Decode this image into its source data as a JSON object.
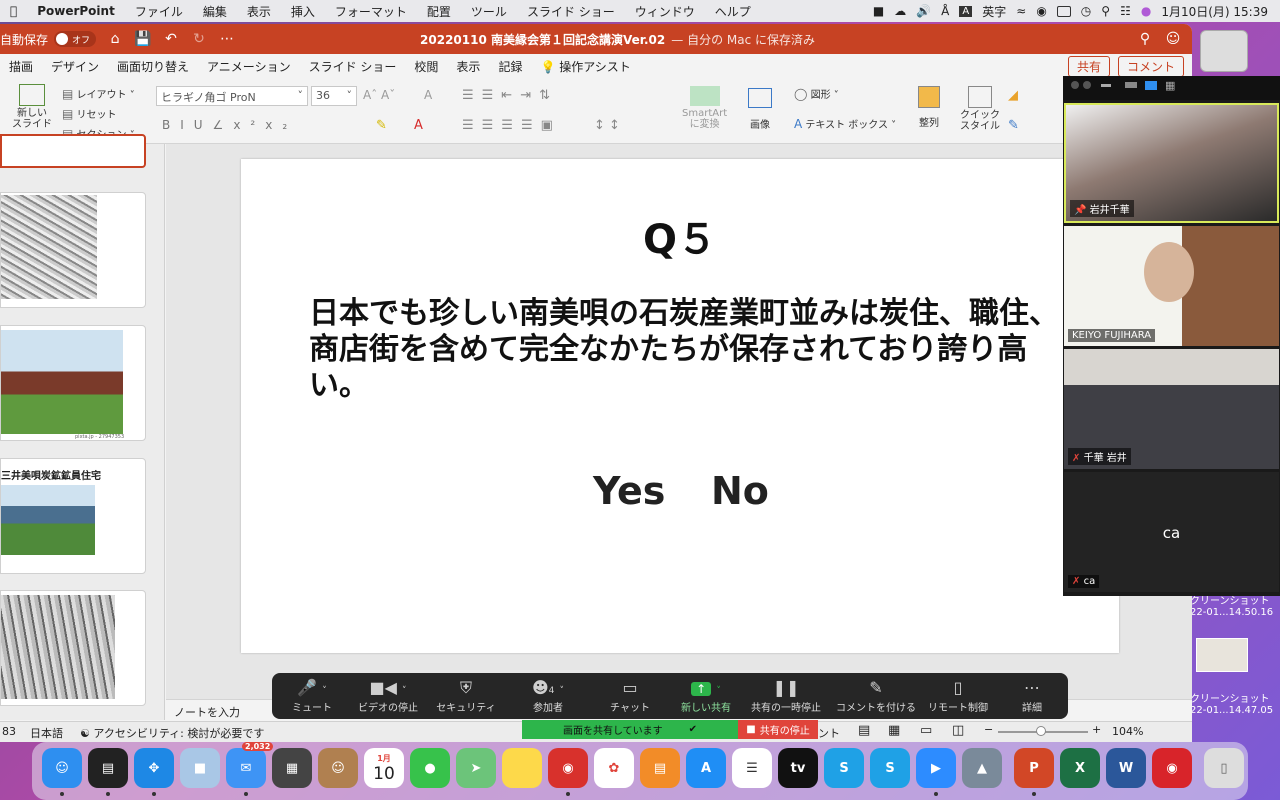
{
  "menubar": {
    "app": "PowerPoint",
    "items": [
      "ファイル",
      "編集",
      "表示",
      "挿入",
      "フォーマット",
      "配置",
      "ツール",
      "スライド ショー",
      "ウィンドウ",
      "ヘルプ"
    ],
    "input_mode": "英字",
    "datetime": "1月10日(月)  15:39"
  },
  "titlebar": {
    "autosave": "自動保存",
    "toggle": "オフ",
    "doc_title": "20220110 南美縁会第１回記念講演Ver.02",
    "saved": "— 自分の Mac に保存済み"
  },
  "tabs": [
    "描画",
    "デザイン",
    "画面切り替え",
    "アニメーション",
    "スライド ショー",
    "校閲",
    "表示",
    "記録",
    "操作アシスト"
  ],
  "right_tabs": {
    "share": "共有",
    "comment": "コメント"
  },
  "ribbon": {
    "new_slide": "新しい\nスライド",
    "layout": "レイアウト",
    "reset": "リセット",
    "section": "セクション",
    "font": "ヒラギノ角ゴ ProN",
    "size": "36",
    "smartart": "SmartArt\nに変換",
    "image": "画像",
    "shapes": "図形",
    "textbox": "テキスト ボックス",
    "arrange": "整列",
    "quick_style": "クイック\nスタイル"
  },
  "thumbs": {
    "caption1": "三井美唄炭鉱鉱員住宅",
    "tiny": "pixta.jp - 27947353"
  },
  "slide": {
    "title": "Q５",
    "body": "日本でも珍しい南美唄の石炭産業町並みは炭住、職住、商店街を含めて完全なかたちが保存されており誇り高い。",
    "yes": "Yes",
    "no": "No"
  },
  "notes_placeholder": "ノートを入力",
  "status": {
    "slide_num": "83",
    "lang": "日本語",
    "accessibility": "アクセシビリティ: 検討が必要です",
    "comment": "ント",
    "zoom": "104%"
  },
  "zoom_toolbar": {
    "mute": "ミュート",
    "video": "ビデオの停止",
    "security": "セキュリティ",
    "participants": "参加者",
    "participants_count": "4",
    "chat": "チャット",
    "new_share": "新しい共有",
    "pause": "共有の一時停止",
    "annotate": "コメントを付ける",
    "remote": "リモート制御",
    "more": "詳細"
  },
  "sharing": {
    "status": "画面を共有しています",
    "stop": "共有の停止"
  },
  "gallery": [
    {
      "name": "岩井千華"
    },
    {
      "name": "KEIYO FUJIHARA"
    },
    {
      "name": "千華 岩井"
    },
    {
      "name": "ca",
      "initials": "ca"
    }
  ],
  "desktop": {
    "file1a": "クリーンショット",
    "file1b": "22-01...14.50.16",
    "file2a": "クリーンショット",
    "file2b": "22-01...14.47.05"
  },
  "dock": {
    "mail_badge": "2,032",
    "cal_month": "1月",
    "cal_day": "10"
  },
  "colors": {
    "ppt_red": "#c74223",
    "zoom_green": "#2db54b",
    "stop_red": "#e0443b"
  }
}
